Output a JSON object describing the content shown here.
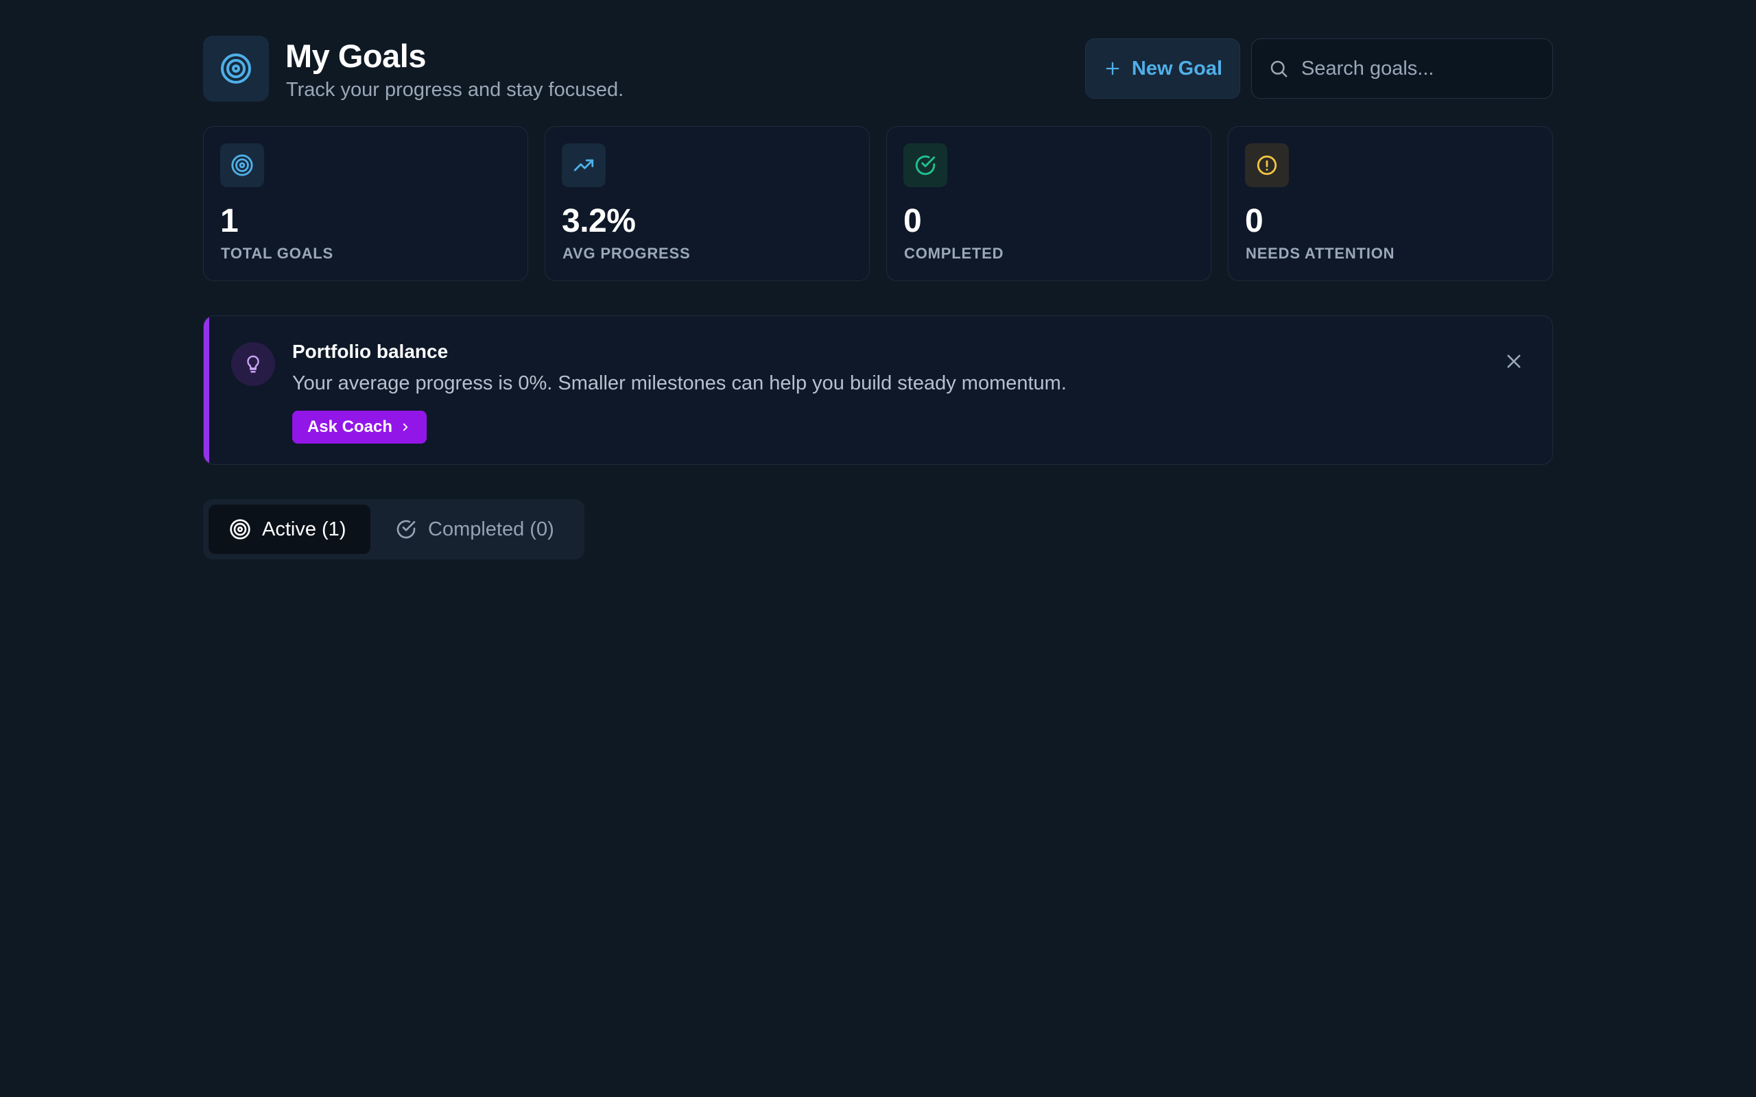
{
  "header": {
    "title": "My Goals",
    "subtitle": "Track your progress and stay focused.",
    "new_goal_label": "New Goal",
    "search_placeholder": "Search goals..."
  },
  "stats": [
    {
      "value": "1",
      "label": "TOTAL GOALS",
      "icon": "target-icon",
      "color": "#4fb0e8"
    },
    {
      "value": "3.2%",
      "label": "AVG PROGRESS",
      "icon": "trending-up-icon",
      "color": "#4fb0e8"
    },
    {
      "value": "0",
      "label": "COMPLETED",
      "icon": "check-circle-icon",
      "color": "#22c38e"
    },
    {
      "value": "0",
      "label": "NEEDS ATTENTION",
      "icon": "alert-circle-icon",
      "color": "#f5c542"
    }
  ],
  "insight": {
    "title": "Portfolio balance",
    "message": "Your average progress is 0%. Smaller milestones can help you build steady momentum.",
    "button_label": "Ask Coach",
    "icon": "lightbulb-icon",
    "accent_color": "#9333ea"
  },
  "tabs": [
    {
      "label": "Active (1)",
      "icon": "target-icon",
      "active": true
    },
    {
      "label": "Completed (0)",
      "icon": "check-circle-icon",
      "active": false
    }
  ]
}
